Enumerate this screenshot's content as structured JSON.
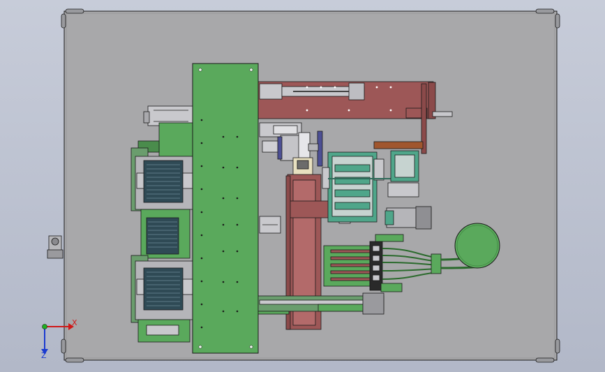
{
  "triad": {
    "x_label": "X",
    "z_label": "Z"
  },
  "colors": {
    "background_top": "#c7ccd9",
    "plate": "#a9a9a9",
    "green": "#5aa95c",
    "red": "#9a5656",
    "teal": "#4ba88a",
    "outline": "#1a1a1a"
  }
}
